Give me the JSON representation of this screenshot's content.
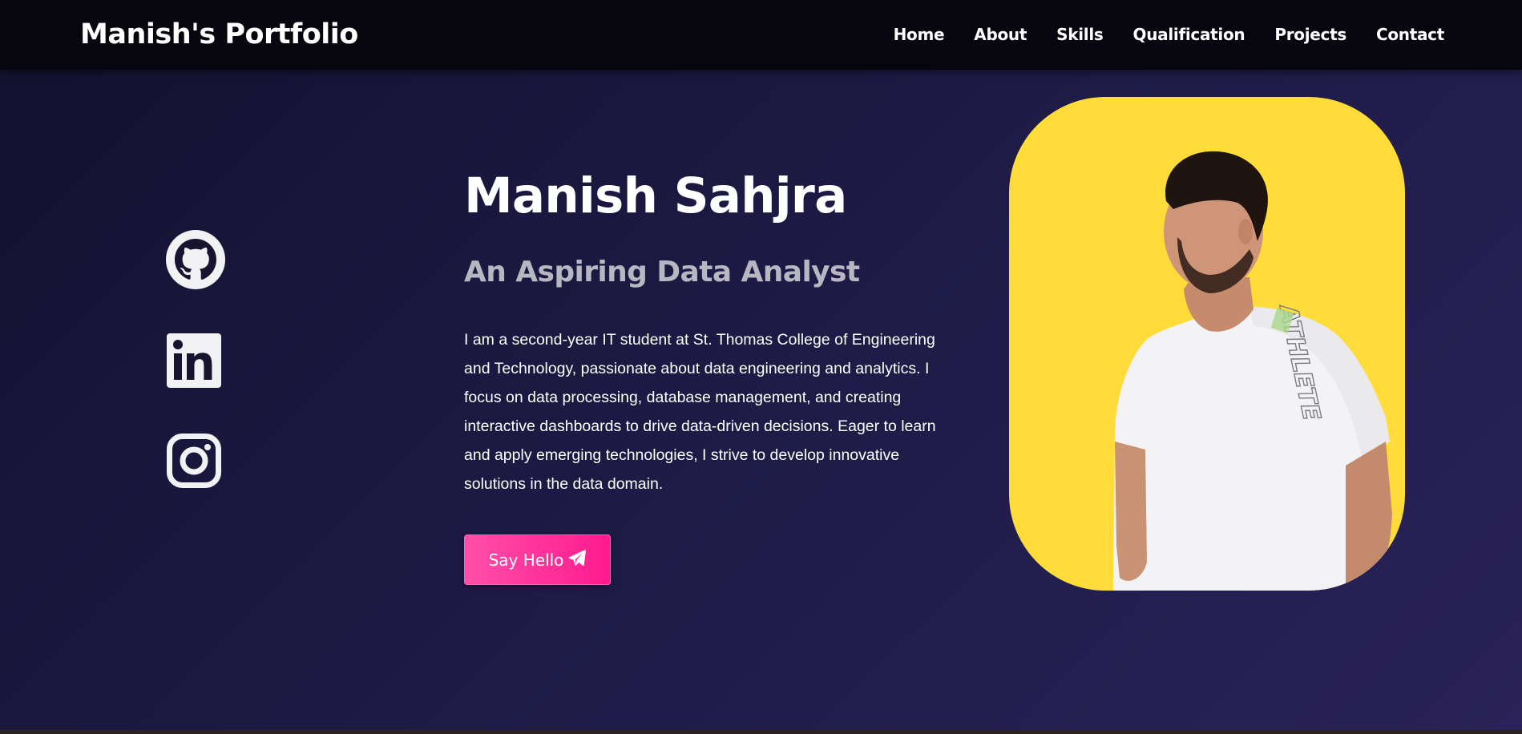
{
  "navbar": {
    "brand": "Manish's Portfolio",
    "links": [
      "Home",
      "About",
      "Skills",
      "Qualification",
      "Projects",
      "Contact"
    ]
  },
  "socials": {
    "icons": [
      "github-icon",
      "linkedin-icon",
      "instagram-icon"
    ]
  },
  "hero": {
    "name": "Manish Sahjra",
    "subtitle": "An Aspiring Data Analyst",
    "description": "I am a second-year IT student at St. Thomas College of Engineering and Technology, passionate about data engineering and analytics. I focus on data processing, database management, and creating interactive dashboards to drive data-driven decisions. Eager to learn and apply emerging technologies, I strive to develop innovative solutions in the data domain.",
    "button_label": "Say Hello",
    "button_icon": "paper-plane-icon"
  },
  "photo": {
    "shirt_text": "ATHLETE",
    "background_color": "#ffdc3a"
  },
  "colors": {
    "accent": "#ff1a8e",
    "nav_bg": "#07060f",
    "subtitle": "#b8b6c0"
  }
}
